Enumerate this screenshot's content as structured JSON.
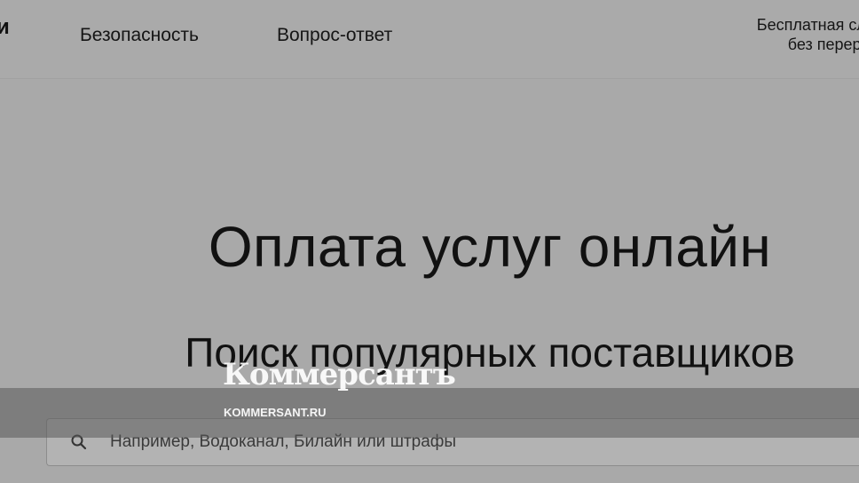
{
  "header": {
    "logo_fragment": "и",
    "nav": [
      {
        "label": "Безопасность"
      },
      {
        "label": "Вопрос-ответ"
      }
    ],
    "support_line1": "Бесплатная служба по",
    "support_line2": "без перерывов и в"
  },
  "main": {
    "title": "Оплата услуг онлайн",
    "subtitle": "Поиск популярных поставщиков",
    "search": {
      "placeholder": "Например, Водоканал, Билайн или штрафы",
      "icon": "search-icon"
    }
  },
  "watermark": {
    "logo": "Коммерсантъ",
    "url": "KOMMERSANT.RU"
  },
  "colors": {
    "background": "#a9a9a9",
    "text": "#111111"
  }
}
